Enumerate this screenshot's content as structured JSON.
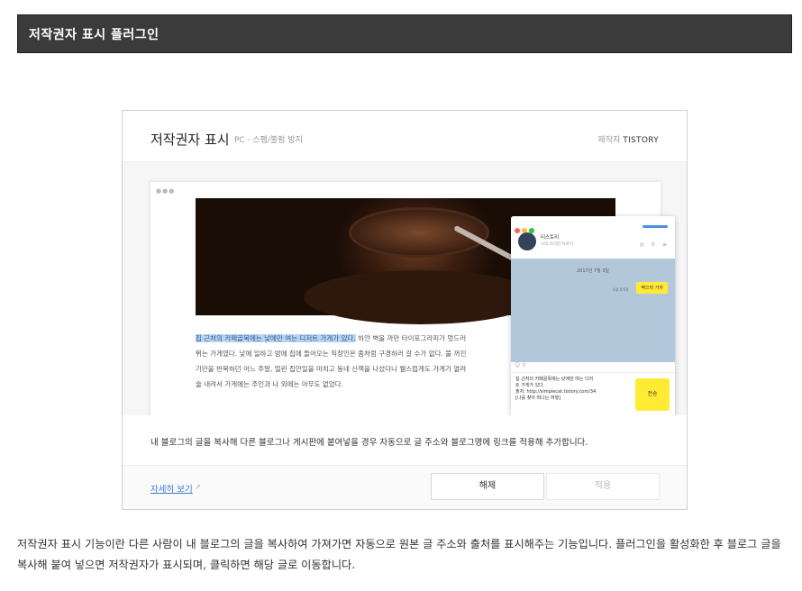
{
  "header": {
    "title": "저작권자 표시 플러그인"
  },
  "panel": {
    "title": "저작권자 표시",
    "subtitle": "PC · 스팸/불펌 방지",
    "maker_label": "제작자",
    "maker_name": "TISTORY"
  },
  "preview": {
    "browser_dots": "●●●",
    "article_highlight": "집 근처의 카페골목에는 낮에만 여는 디저트 가게가 있다.",
    "article_rest_1": " 하얀 벽을 까만 타이포그라피가 멋드러",
    "article_line_2": "뛰는 가게였다. 낮에 일하고 밤에 집에 들어오는 직장인은 좀처럼 구경하러 갈 수가 없다. 불 꺼진",
    "article_line_3": "기만을 반복하던 어느 주말, 밀린 집안일을 마치고 동네 산책을 나섰더니 웰스럽게도 가게가 열려",
    "article_line_4": "술 내려서 가게에는 주인과 나 외에는 아무도 없었다.",
    "chat": {
      "name": "티스토리",
      "desc": "나의 즉석한 이야기",
      "icons": "◎ ⚲ ≡",
      "date": "2017년 7월 3일",
      "bubble": "벽으러 가자",
      "bubble_time": "오후 6:58",
      "tools": "☺ ⚲",
      "input_line_1": "집 근처의 카페골목에는 낮에만 여는 디저",
      "input_line_2": "트 가게가 있다.",
      "input_line_3": "출처: http://simplecat.tistory.com/34",
      "input_line_4": "[나를 찾아 떠나는 여행]",
      "send": "전송"
    }
  },
  "description": "내 블로그의 글을 복사해 다른 블로그나 게시판에 붙여넣을 경우 자동으로 글 주소와 블로그명에 링크를 적용해 추가합니다.",
  "footer": {
    "more_link": "자세히 보기",
    "more_icon": "↗",
    "off_button": "해제",
    "apply_button": "적용"
  },
  "explain": "저작권자 표시 기능이란 다른 사람이 내 블로그의 글을 복사하여 가져가면 자동으로 원본 글 주소와 출처를 표시해주는 기능입니다. 플러그인을 활성화한 후 블로그 글을 복사해 붙여 넣으면 저작권자가 표시되며, 클릭하면 해당 글로 이동합니다.",
  "colors": {
    "header_bg": "#3b3b3b",
    "link": "#3a7bd5",
    "chat_bubble": "#ffeb33",
    "chat_bg": "#b2c7d9"
  }
}
